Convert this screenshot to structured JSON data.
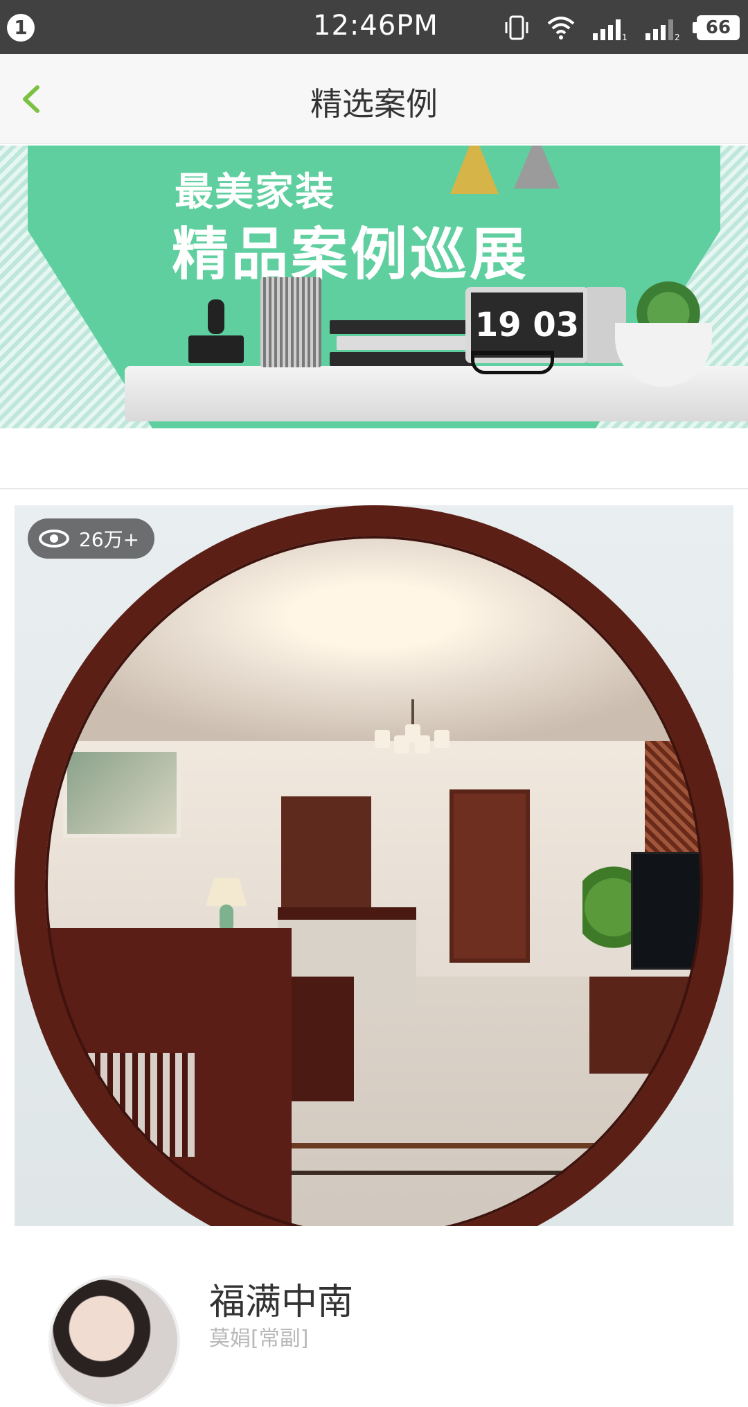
{
  "status_bar": {
    "notification_count": "1",
    "time": "12:46PM",
    "battery": "66",
    "icons": [
      "vibrate-icon",
      "wifi-icon",
      "signal-1-icon",
      "signal-2-icon",
      "battery-icon"
    ]
  },
  "header": {
    "title": "精选案例",
    "back_icon": "chevron-left-icon",
    "accent_color": "#7cc142"
  },
  "banner": {
    "line1": "最美家装",
    "line2": "精品案例巡展",
    "clock_text": "19 03",
    "bg_color": "#5fcf9f"
  },
  "case": {
    "views": "26万+",
    "title": "福满中南",
    "subtitle": "莫娟[常副]"
  }
}
